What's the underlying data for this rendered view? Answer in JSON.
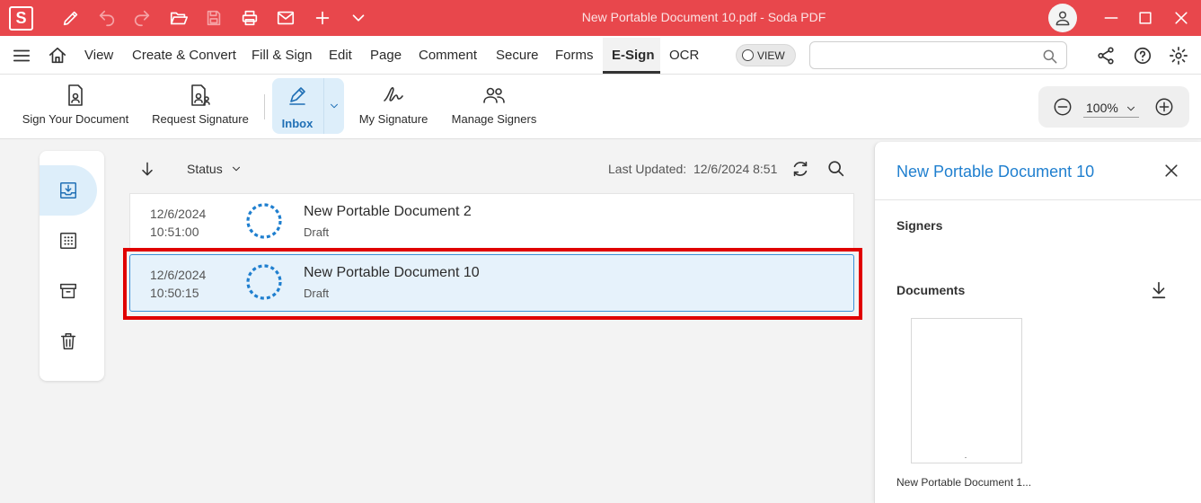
{
  "titlebar": {
    "logo_letter": "S",
    "title": "New Portable Document 10.pdf  -  Soda PDF",
    "icons": [
      "pen-icon",
      "undo-icon",
      "redo-icon",
      "open-folder-icon",
      "save-icon",
      "print-icon",
      "mail-icon",
      "plus-icon",
      "chevron-down-icon",
      "user-icon",
      "minimize-icon",
      "maximize-icon",
      "close-icon"
    ]
  },
  "menu": {
    "items": [
      "View",
      "Create & Convert",
      "Fill & Sign",
      "Edit",
      "Page",
      "Comment",
      "Secure",
      "Forms",
      "E-Sign",
      "OCR"
    ],
    "active": "E-Sign",
    "view_toggle": "VIEW",
    "search_placeholder": ""
  },
  "ribbon": {
    "sign_your_document": "Sign Your Document",
    "request_signature": "Request Signature",
    "inbox": "Inbox",
    "my_signature": "My Signature",
    "manage_signers": "Manage Signers",
    "zoom": "100%"
  },
  "list": {
    "status_filter": "Status",
    "last_updated_label": "Last Updated:",
    "last_updated_value": "12/6/2024 8:51",
    "rows": [
      {
        "date": "12/6/2024",
        "time": "10:51:00",
        "name": "New Portable Document 2",
        "status": "Draft",
        "selected": false
      },
      {
        "date": "12/6/2024",
        "time": "10:50:15",
        "name": "New Portable Document 10",
        "status": "Draft",
        "selected": true
      }
    ]
  },
  "panel": {
    "title": "New Portable Document 10",
    "signers_label": "Signers",
    "documents_label": "Documents",
    "thumb_label": "New Portable Document 1..."
  },
  "colors": {
    "brand": "#e8474c",
    "accent": "#1f7fcf",
    "highlight": "#e00000",
    "selected_row": "#e6f2fb"
  }
}
